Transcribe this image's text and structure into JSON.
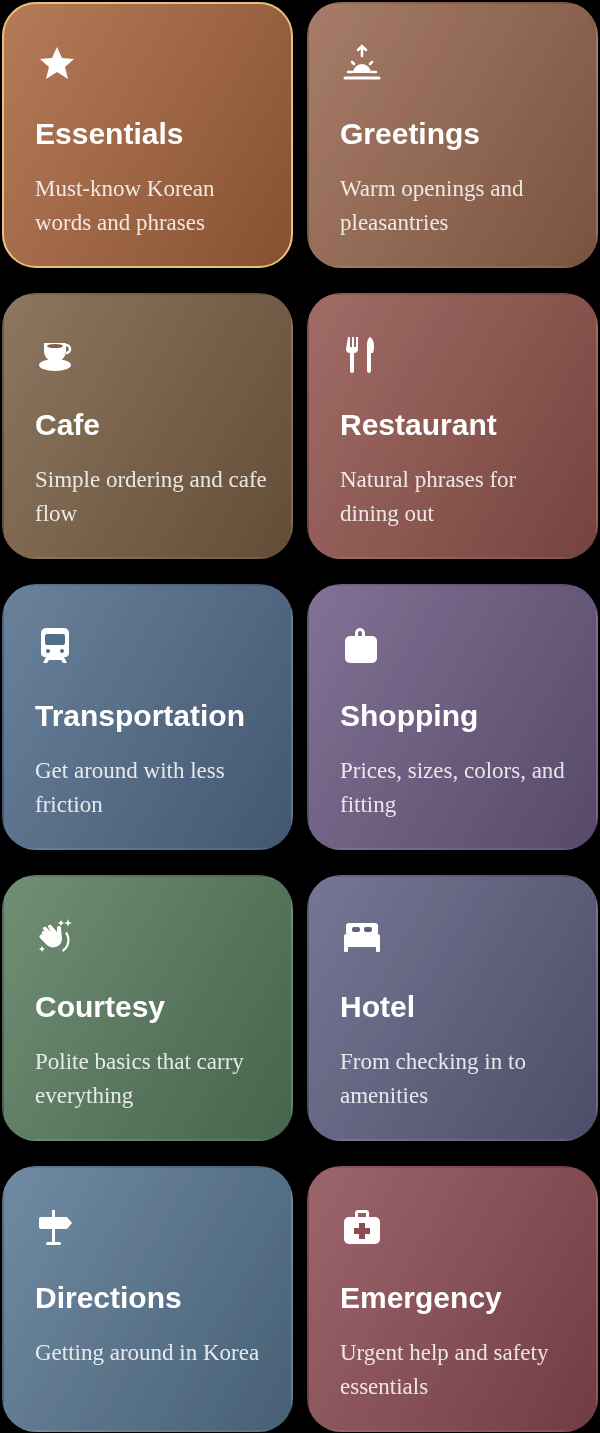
{
  "categories": [
    {
      "title": "Essentials",
      "description": "Must-know Korean words and phrases",
      "kind": "star",
      "color": "#a8653d",
      "selected": true
    },
    {
      "title": "Greetings",
      "description": "Warm openings and pleasantries",
      "kind": "sunrise",
      "color": "#98674f",
      "selected": false
    },
    {
      "title": "Cafe",
      "description": "Simple ordering and cafe flow",
      "kind": "cup",
      "color": "#7b6045",
      "selected": false
    },
    {
      "title": "Restaurant",
      "description": "Natural phrases for dining out",
      "kind": "cutlery",
      "color": "#92544d",
      "selected": false
    },
    {
      "title": "Transportation",
      "description": "Get around with less friction",
      "kind": "train",
      "color": "#526d8c",
      "selected": false
    },
    {
      "title": "Shopping",
      "description": "Prices, sizes, colors, and fitting",
      "kind": "bag",
      "color": "#6d5b84",
      "selected": false
    },
    {
      "title": "Courtesy",
      "description": "Polite basics that carry everything",
      "kind": "hands",
      "color": "#587c5e",
      "selected": false
    },
    {
      "title": "Hotel",
      "description": "From checking in to amenities",
      "kind": "bed",
      "color": "#5f6082",
      "selected": false
    },
    {
      "title": "Directions",
      "description": "Getting around in Korea",
      "kind": "sign",
      "color": "#587792",
      "selected": false
    },
    {
      "title": "Emergency",
      "description": "Urgent help and safety essentials",
      "kind": "medkit",
      "color": "#8c4c53",
      "selected": false
    }
  ]
}
